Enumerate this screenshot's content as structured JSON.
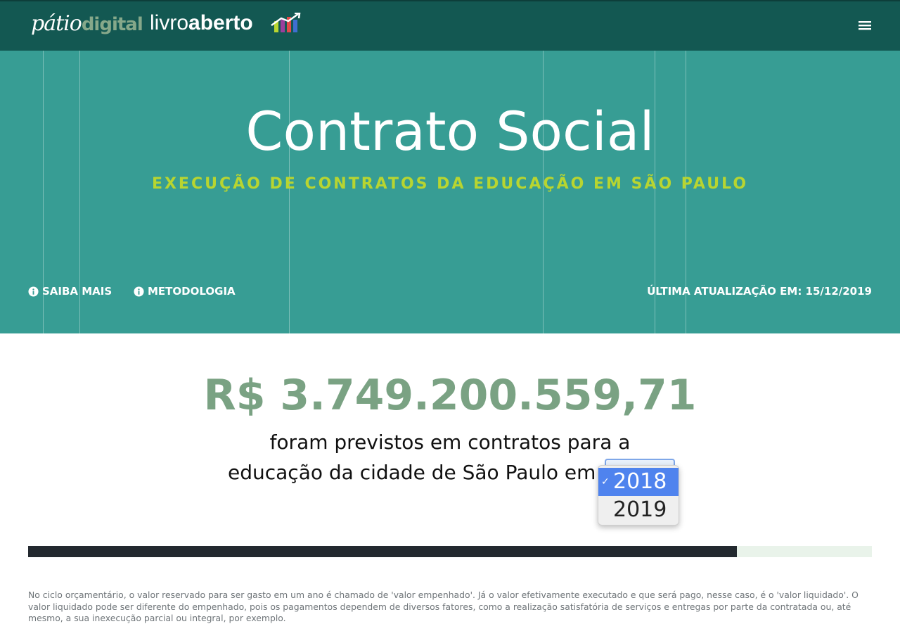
{
  "navbar": {
    "logo_patio_part1": "pátio",
    "logo_patio_part2": "digital",
    "logo_livro_part1": "livro",
    "logo_livro_part2": "aberto"
  },
  "hero": {
    "title": "Contrato Social",
    "subtitle": "EXECUÇÃO DE CONTRATOS DA EDUCAÇÃO EM SÃO PAULO",
    "links": [
      "SAIBA MAIS",
      "METODOLOGIA"
    ],
    "last_update": "ÚLTIMA ATUALIZAÇÃO EM: 15/12/2019"
  },
  "main": {
    "amount": "R$ 3.749.200.559,71",
    "line1": "foram previstos em contratos para a",
    "line2": "educação da cidade de São Paulo em",
    "year_select": {
      "options": [
        "2018",
        "2019"
      ],
      "selected": "2018"
    },
    "progress": {
      "fraction": 0.84
    },
    "footnote": "No ciclo orçamentário, o valor reservado para ser gasto em um ano é chamado de 'valor empenhado'. Já o valor efetivamente executado e que será pago, nesse caso, é o 'valor liquidado'. O valor liquidado pode ser diferente do empenhado, pois os pagamentos dependem de diversos fatores, como a realização satisfatória de serviços e entregas por parte da contratada ou, até mesmo, a sua inexecução parcial ou integral, por exemplo."
  },
  "colors": {
    "navbar": "#135852",
    "hero": "#379d94",
    "subtitle": "#b8d530",
    "amount": "#7aa283",
    "progress_fill": "#23292f",
    "progress_track": "#e9f3ea",
    "select_highlight": "#4f83ee"
  },
  "icons": {
    "menu": "hamburger-menu-icon",
    "info": "info-circle-icon",
    "check": "checkmark-icon",
    "logo_bars": "bar-chart-arrow-icon"
  }
}
